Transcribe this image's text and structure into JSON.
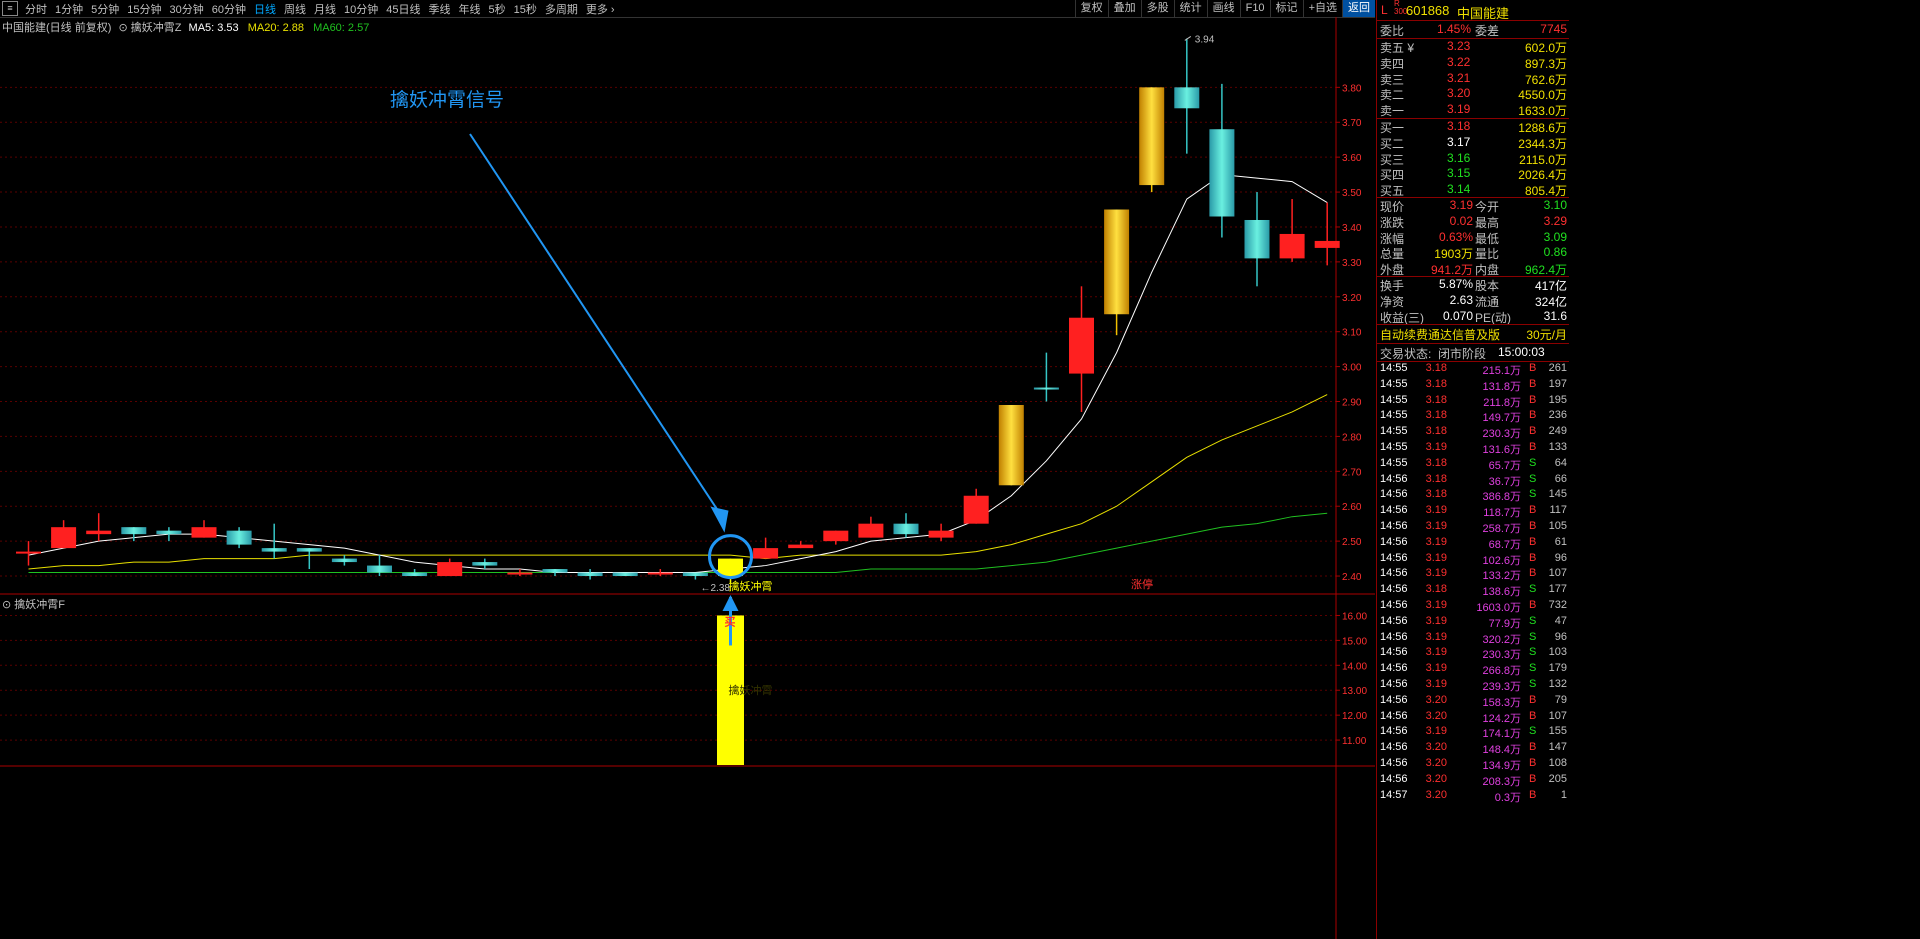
{
  "periods": [
    "分时",
    "1分钟",
    "5分钟",
    "15分钟",
    "30分钟",
    "60分钟",
    "日线",
    "周线",
    "月线",
    "10分钟",
    "45日线",
    "季线",
    "年线",
    "5秒",
    "15秒",
    "多周期",
    "更多 ›"
  ],
  "active_period": "日线",
  "tools": [
    "复权",
    "叠加",
    "多股",
    "统计",
    "画线",
    "F10",
    "标记",
    "+自选",
    "返回"
  ],
  "main_legend": {
    "name": "中国能建(日线 前复权)",
    "indicator": "擒妖冲霄Z",
    "ma5": "MA5: 3.53",
    "ma20": "MA20: 2.88",
    "ma60": "MA60: 2.57"
  },
  "sub_legend": "擒妖冲霄F",
  "annotation": "擒妖冲霄信号",
  "signal_label": "擒妖冲霄",
  "signal_label_sub": "擒妖冲霄",
  "buy_mark": "买",
  "zhangting": "涨停",
  "high_label": "3.94",
  "low_label": "2.38",
  "price_axis": [
    "3.80",
    "3.70",
    "3.60",
    "3.50",
    "3.40",
    "3.30",
    "3.20",
    "3.10",
    "3.00",
    "2.90",
    "2.80",
    "2.70",
    "2.60",
    "2.50",
    "2.40"
  ],
  "sub_axis": [
    "16.00",
    "15.00",
    "14.00",
    "13.00",
    "12.00",
    "11.00"
  ],
  "colors": {
    "up": "#ff2020",
    "down": "#36c6c6",
    "limit": "#f0c000",
    "ma5": "#ffffff",
    "ma20": "#e8e000",
    "ma60": "#20c020",
    "grid": "#5a0000",
    "signal": "#ffff00",
    "annot": "#2196f3"
  },
  "chart_data": {
    "type": "candlestick",
    "ylim": [
      2.36,
      3.97
    ],
    "candles": [
      {
        "o": 2.47,
        "h": 2.5,
        "l": 2.43,
        "c": 2.47,
        "t": "u"
      },
      {
        "o": 2.48,
        "h": 2.56,
        "l": 2.48,
        "c": 2.54,
        "t": "u"
      },
      {
        "o": 2.52,
        "h": 2.58,
        "l": 2.5,
        "c": 2.53,
        "t": "u"
      },
      {
        "o": 2.54,
        "h": 2.54,
        "l": 2.5,
        "c": 2.52,
        "t": "d"
      },
      {
        "o": 2.53,
        "h": 2.54,
        "l": 2.5,
        "c": 2.52,
        "t": "d"
      },
      {
        "o": 2.51,
        "h": 2.56,
        "l": 2.51,
        "c": 2.54,
        "t": "u"
      },
      {
        "o": 2.53,
        "h": 2.54,
        "l": 2.48,
        "c": 2.49,
        "t": "d"
      },
      {
        "o": 2.48,
        "h": 2.55,
        "l": 2.45,
        "c": 2.47,
        "t": "d"
      },
      {
        "o": 2.48,
        "h": 2.48,
        "l": 2.42,
        "c": 2.47,
        "t": "d"
      },
      {
        "o": 2.45,
        "h": 2.46,
        "l": 2.43,
        "c": 2.44,
        "t": "d"
      },
      {
        "o": 2.43,
        "h": 2.46,
        "l": 2.4,
        "c": 2.41,
        "t": "d"
      },
      {
        "o": 2.41,
        "h": 2.42,
        "l": 2.4,
        "c": 2.4,
        "t": "d"
      },
      {
        "o": 2.4,
        "h": 2.45,
        "l": 2.4,
        "c": 2.44,
        "t": "u"
      },
      {
        "o": 2.44,
        "h": 2.45,
        "l": 2.42,
        "c": 2.43,
        "t": "d"
      },
      {
        "o": 2.41,
        "h": 2.42,
        "l": 2.4,
        "c": 2.41,
        "t": "u"
      },
      {
        "o": 2.42,
        "h": 2.42,
        "l": 2.4,
        "c": 2.41,
        "t": "d"
      },
      {
        "o": 2.41,
        "h": 2.42,
        "l": 2.39,
        "c": 2.4,
        "t": "d"
      },
      {
        "o": 2.41,
        "h": 2.41,
        "l": 2.4,
        "c": 2.4,
        "t": "d"
      },
      {
        "o": 2.41,
        "h": 2.42,
        "l": 2.4,
        "c": 2.41,
        "t": "u"
      },
      {
        "o": 2.41,
        "h": 2.41,
        "l": 2.39,
        "c": 2.4,
        "t": "d"
      },
      {
        "o": 2.4,
        "h": 2.45,
        "l": 2.38,
        "c": 2.45,
        "t": "s"
      },
      {
        "o": 2.45,
        "h": 2.51,
        "l": 2.45,
        "c": 2.48,
        "t": "u"
      },
      {
        "o": 2.48,
        "h": 2.5,
        "l": 2.48,
        "c": 2.49,
        "t": "u"
      },
      {
        "o": 2.5,
        "h": 2.53,
        "l": 2.49,
        "c": 2.53,
        "t": "u"
      },
      {
        "o": 2.51,
        "h": 2.57,
        "l": 2.51,
        "c": 2.55,
        "t": "u"
      },
      {
        "o": 2.55,
        "h": 2.58,
        "l": 2.51,
        "c": 2.52,
        "t": "d"
      },
      {
        "o": 2.51,
        "h": 2.55,
        "l": 2.5,
        "c": 2.53,
        "t": "u"
      },
      {
        "o": 2.55,
        "h": 2.65,
        "l": 2.55,
        "c": 2.63,
        "t": "u"
      },
      {
        "o": 2.66,
        "h": 2.89,
        "l": 2.66,
        "c": 2.89,
        "t": "l"
      },
      {
        "o": 2.94,
        "h": 3.04,
        "l": 2.9,
        "c": 2.94,
        "t": "d"
      },
      {
        "o": 2.98,
        "h": 3.23,
        "l": 2.87,
        "c": 3.14,
        "t": "u"
      },
      {
        "o": 3.15,
        "h": 3.45,
        "l": 3.09,
        "c": 3.45,
        "t": "l"
      },
      {
        "o": 3.52,
        "h": 3.8,
        "l": 3.5,
        "c": 3.8,
        "t": "l"
      },
      {
        "o": 3.8,
        "h": 3.94,
        "l": 3.61,
        "c": 3.74,
        "t": "d"
      },
      {
        "o": 3.68,
        "h": 3.81,
        "l": 3.37,
        "c": 3.43,
        "t": "d"
      },
      {
        "o": 3.42,
        "h": 3.5,
        "l": 3.23,
        "c": 3.31,
        "t": "d"
      },
      {
        "o": 3.31,
        "h": 3.48,
        "l": 3.3,
        "c": 3.38,
        "t": "u"
      },
      {
        "o": 3.34,
        "h": 3.47,
        "l": 3.29,
        "c": 3.36,
        "t": "u"
      }
    ],
    "ma5": [
      2.46,
      2.48,
      2.5,
      2.51,
      2.52,
      2.52,
      2.51,
      2.5,
      2.49,
      2.48,
      2.46,
      2.44,
      2.43,
      2.42,
      2.42,
      2.41,
      2.41,
      2.41,
      2.41,
      2.41,
      2.42,
      2.43,
      2.45,
      2.47,
      2.5,
      2.51,
      2.52,
      2.56,
      2.63,
      2.73,
      2.85,
      3.04,
      3.27,
      3.48,
      3.55,
      3.54,
      3.53,
      3.47
    ],
    "ma20": [
      2.42,
      2.43,
      2.43,
      2.44,
      2.44,
      2.45,
      2.45,
      2.45,
      2.46,
      2.46,
      2.46,
      2.46,
      2.46,
      2.46,
      2.46,
      2.46,
      2.46,
      2.46,
      2.46,
      2.46,
      2.46,
      2.45,
      2.46,
      2.46,
      2.46,
      2.46,
      2.46,
      2.47,
      2.49,
      2.52,
      2.55,
      2.6,
      2.67,
      2.74,
      2.79,
      2.83,
      2.87,
      2.92
    ],
    "ma60": [
      2.41,
      2.41,
      2.41,
      2.41,
      2.41,
      2.41,
      2.41,
      2.41,
      2.41,
      2.41,
      2.41,
      2.41,
      2.41,
      2.41,
      2.41,
      2.41,
      2.41,
      2.41,
      2.41,
      2.41,
      2.41,
      2.41,
      2.41,
      2.41,
      2.42,
      2.42,
      2.42,
      2.42,
      2.43,
      2.44,
      2.46,
      2.48,
      2.5,
      2.52,
      2.54,
      2.55,
      2.57,
      2.58
    ],
    "signal_bar": {
      "index": 20,
      "value": 16.0,
      "ylim": [
        10.0,
        16.5
      ]
    }
  },
  "quote": {
    "code": "601868",
    "name": "中国能建",
    "weibi_label": "委比",
    "weibi": "1.45%",
    "weicha_label": "委差",
    "weicha": "7745",
    "sell": [
      {
        "label": "卖五 ¥",
        "price": "3.23",
        "vol": "602.0万"
      },
      {
        "label": "卖四",
        "price": "3.22",
        "vol": "897.3万"
      },
      {
        "label": "卖三",
        "price": "3.21",
        "vol": "762.6万"
      },
      {
        "label": "卖二",
        "price": "3.20",
        "vol": "4550.0万"
      },
      {
        "label": "卖一",
        "price": "3.19",
        "vol": "1633.0万"
      }
    ],
    "buy": [
      {
        "label": "买一",
        "price": "3.18",
        "vol": "1288.6万",
        "c": "#ff3030"
      },
      {
        "label": "买二",
        "price": "3.17",
        "vol": "2344.3万",
        "c": "#ffffff"
      },
      {
        "label": "买三",
        "price": "3.16",
        "vol": "2115.0万",
        "c": "#20e020"
      },
      {
        "label": "买四",
        "price": "3.15",
        "vol": "2026.4万",
        "c": "#20e020"
      },
      {
        "label": "买五",
        "price": "3.14",
        "vol": "805.4万",
        "c": "#20e020"
      }
    ],
    "stats": [
      {
        "l1": "现价",
        "v1": "3.19",
        "c1": "#ff3030",
        "l2": "今开",
        "v2": "3.10",
        "c2": "#20e020"
      },
      {
        "l1": "涨跌",
        "v1": "0.02",
        "c1": "#ff3030",
        "l2": "最高",
        "v2": "3.29",
        "c2": "#ff3030"
      },
      {
        "l1": "涨幅",
        "v1": "0.63%",
        "c1": "#ff3030",
        "l2": "最低",
        "v2": "3.09",
        "c2": "#20e020"
      },
      {
        "l1": "总量",
        "v1": "1903万",
        "c1": "#f0e000",
        "l2": "量比",
        "v2": "0.86",
        "c2": "#20e020"
      },
      {
        "l1": "外盘",
        "v1": "941.2万",
        "c1": "#ff3030",
        "l2": "内盘",
        "v2": "962.4万",
        "c2": "#20e020"
      }
    ],
    "stats2": [
      {
        "l1": "换手",
        "v1": "5.87%",
        "l2": "股本",
        "v2": "417亿"
      },
      {
        "l1": "净资",
        "v1": "2.63",
        "l2": "流通",
        "v2": "324亿"
      },
      {
        "l1": "收益(三)",
        "v1": "0.070",
        "l2": "PE(动)",
        "v2": "31.6"
      }
    ],
    "promo": "自动续费通达信普及版",
    "promo_price": "30元/月",
    "status_label": "交易状态:",
    "status": "闭市阶段",
    "status_time": "15:00:03",
    "ticks": [
      [
        "14:55",
        "3.18",
        "215.1万",
        "B",
        "261"
      ],
      [
        "14:55",
        "3.18",
        "131.8万",
        "B",
        "197"
      ],
      [
        "14:55",
        "3.18",
        "211.8万",
        "B",
        "195"
      ],
      [
        "14:55",
        "3.18",
        "149.7万",
        "B",
        "236"
      ],
      [
        "14:55",
        "3.18",
        "230.3万",
        "B",
        "249"
      ],
      [
        "14:55",
        "3.19",
        "131.6万",
        "B",
        "133"
      ],
      [
        "14:55",
        "3.18",
        "65.7万",
        "S",
        "64"
      ],
      [
        "14:56",
        "3.18",
        "36.7万",
        "S",
        "66"
      ],
      [
        "14:56",
        "3.18",
        "386.8万",
        "S",
        "145"
      ],
      [
        "14:56",
        "3.19",
        "118.7万",
        "B",
        "117"
      ],
      [
        "14:56",
        "3.19",
        "258.7万",
        "B",
        "105"
      ],
      [
        "14:56",
        "3.19",
        "68.7万",
        "B",
        "61"
      ],
      [
        "14:56",
        "3.19",
        "102.6万",
        "B",
        "96"
      ],
      [
        "14:56",
        "3.19",
        "133.2万",
        "B",
        "107"
      ],
      [
        "14:56",
        "3.18",
        "138.6万",
        "S",
        "177"
      ],
      [
        "14:56",
        "3.19",
        "1603.0万",
        "B",
        "732"
      ],
      [
        "14:56",
        "3.19",
        "77.9万",
        "S",
        "47"
      ],
      [
        "14:56",
        "3.19",
        "320.2万",
        "S",
        "96"
      ],
      [
        "14:56",
        "3.19",
        "230.3万",
        "S",
        "103"
      ],
      [
        "14:56",
        "3.19",
        "266.8万",
        "S",
        "179"
      ],
      [
        "14:56",
        "3.19",
        "239.3万",
        "S",
        "132"
      ],
      [
        "14:56",
        "3.20",
        "158.3万",
        "B",
        "79"
      ],
      [
        "14:56",
        "3.20",
        "124.2万",
        "B",
        "107"
      ],
      [
        "14:56",
        "3.19",
        "174.1万",
        "S",
        "155"
      ],
      [
        "14:56",
        "3.20",
        "148.4万",
        "B",
        "147"
      ],
      [
        "14:56",
        "3.20",
        "134.9万",
        "B",
        "108"
      ],
      [
        "14:56",
        "3.20",
        "208.3万",
        "B",
        "205"
      ],
      [
        "14:57",
        "3.20",
        "0.3万",
        "B",
        "1"
      ]
    ]
  }
}
